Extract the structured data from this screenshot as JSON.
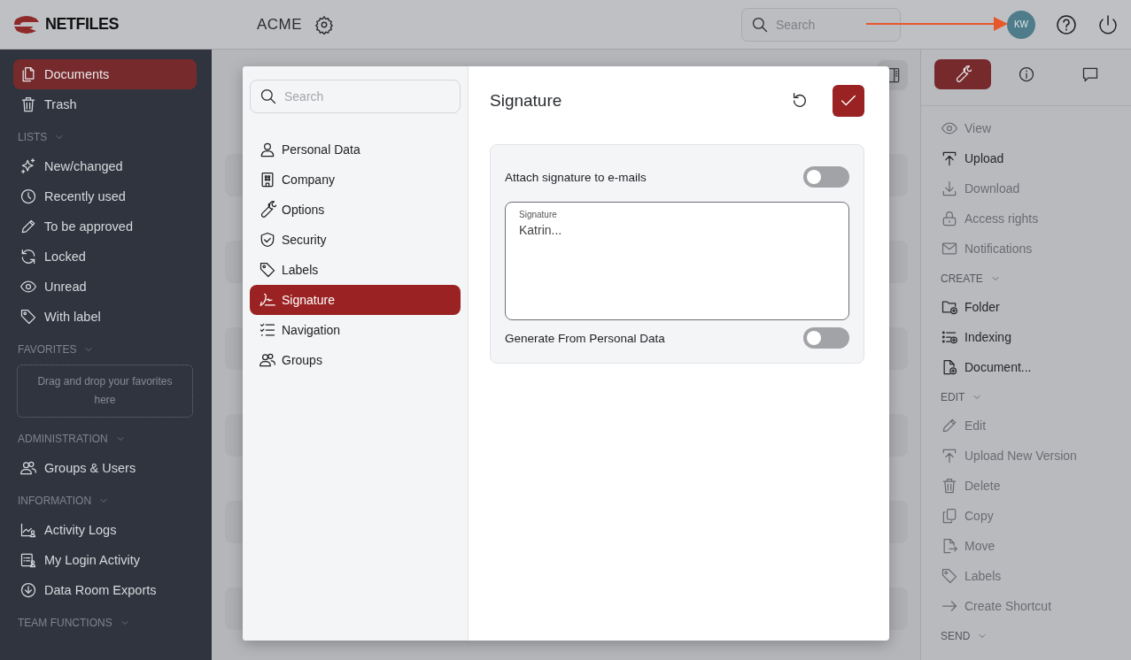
{
  "header": {
    "logo": "NETFILES",
    "workspace": "ACME",
    "search": {
      "placeholder": "Search"
    },
    "avatar": "KW"
  },
  "annotation": {
    "kind": "arrow"
  },
  "sidebar": {
    "sections": [
      {
        "items": [
          {
            "label": "Documents",
            "selected": true
          },
          {
            "label": "Trash",
            "selected": false
          }
        ]
      },
      {
        "label": "LISTS",
        "expanded": true,
        "items": [
          {
            "label": "New/changed",
            "selected": false
          },
          {
            "label": "Recently used",
            "selected": false
          },
          {
            "label": "To be approved",
            "selected": false
          },
          {
            "label": "Locked",
            "selected": false
          },
          {
            "label": "Unread",
            "selected": false
          },
          {
            "label": "With label",
            "selected": false
          }
        ]
      },
      {
        "label": "FAVORITES",
        "expanded": true,
        "dropzone": "Drag and drop your favorites here"
      },
      {
        "label": "ADMINISTRATION",
        "expanded": true,
        "items": [
          {
            "label": "Groups & Users",
            "selected": false
          }
        ]
      },
      {
        "label": "INFORMATION",
        "expanded": true,
        "items": [
          {
            "label": "Activity Logs",
            "selected": false
          },
          {
            "label": "My Login Activity",
            "selected": false
          },
          {
            "label": "Data Room Exports",
            "selected": false
          }
        ]
      },
      {
        "label": "TEAM FUNCTIONS",
        "expanded": true
      }
    ]
  },
  "actions": {
    "tabs": [
      {
        "selected": true
      },
      {
        "selected": false
      },
      {
        "selected": false
      }
    ],
    "sections": [
      {
        "items": [
          {
            "label": "View",
            "disabled": true
          },
          {
            "label": "Upload",
            "disabled": false
          },
          {
            "label": "Download",
            "disabled": true
          },
          {
            "label": "Access rights",
            "disabled": true
          },
          {
            "label": "Notifications",
            "disabled": true
          }
        ]
      },
      {
        "label": "CREATE",
        "expanded": true,
        "items": [
          {
            "label": "Folder",
            "disabled": false
          },
          {
            "label": "Indexing",
            "disabled": false
          },
          {
            "label": "Document...",
            "disabled": false
          }
        ]
      },
      {
        "label": "EDIT",
        "expanded": true,
        "items": [
          {
            "label": "Edit",
            "disabled": true
          },
          {
            "label": "Upload New Version",
            "disabled": true
          },
          {
            "label": "Delete",
            "disabled": true
          },
          {
            "label": "Copy",
            "disabled": true
          },
          {
            "label": "Move",
            "disabled": true
          },
          {
            "label": "Labels",
            "disabled": true
          },
          {
            "label": "Create Shortcut",
            "disabled": true
          }
        ]
      },
      {
        "label": "SEND",
        "expanded": true
      }
    ]
  },
  "dialog": {
    "search": {
      "placeholder": "Search"
    },
    "nav": [
      {
        "label": "Personal Data",
        "selected": false
      },
      {
        "label": "Company",
        "selected": false
      },
      {
        "label": "Options",
        "selected": false
      },
      {
        "label": "Security",
        "selected": false
      },
      {
        "label": "Labels",
        "selected": false
      },
      {
        "label": "Signature",
        "selected": true
      },
      {
        "label": "Navigation",
        "selected": false
      },
      {
        "label": "Groups",
        "selected": false
      }
    ],
    "title": "Signature",
    "settings": [
      {
        "kind": "toggle",
        "label": "Attach signature to e-mails",
        "on": false
      },
      {
        "kind": "textarea",
        "label": "Signature",
        "value": "Katrin..."
      },
      {
        "kind": "toggle",
        "label": "Generate From Personal Data",
        "on": false
      }
    ]
  }
}
